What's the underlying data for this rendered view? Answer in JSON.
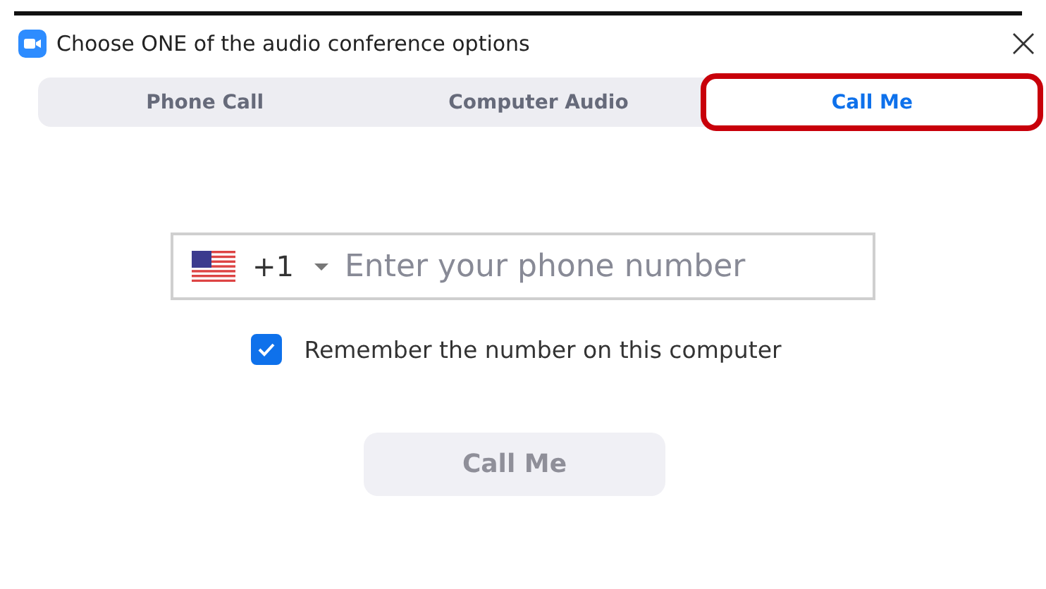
{
  "window": {
    "title": "Choose ONE of the audio conference options"
  },
  "tabs": [
    {
      "label": "Phone Call",
      "selected": false
    },
    {
      "label": "Computer Audio",
      "selected": false
    },
    {
      "label": "Call Me",
      "selected": true
    }
  ],
  "phone": {
    "code": "+1",
    "placeholder": "Enter your phone number"
  },
  "remember": {
    "label": "Remember the number on this computer",
    "checked": true
  },
  "call_button": {
    "label": "Call Me",
    "disabled": true
  }
}
